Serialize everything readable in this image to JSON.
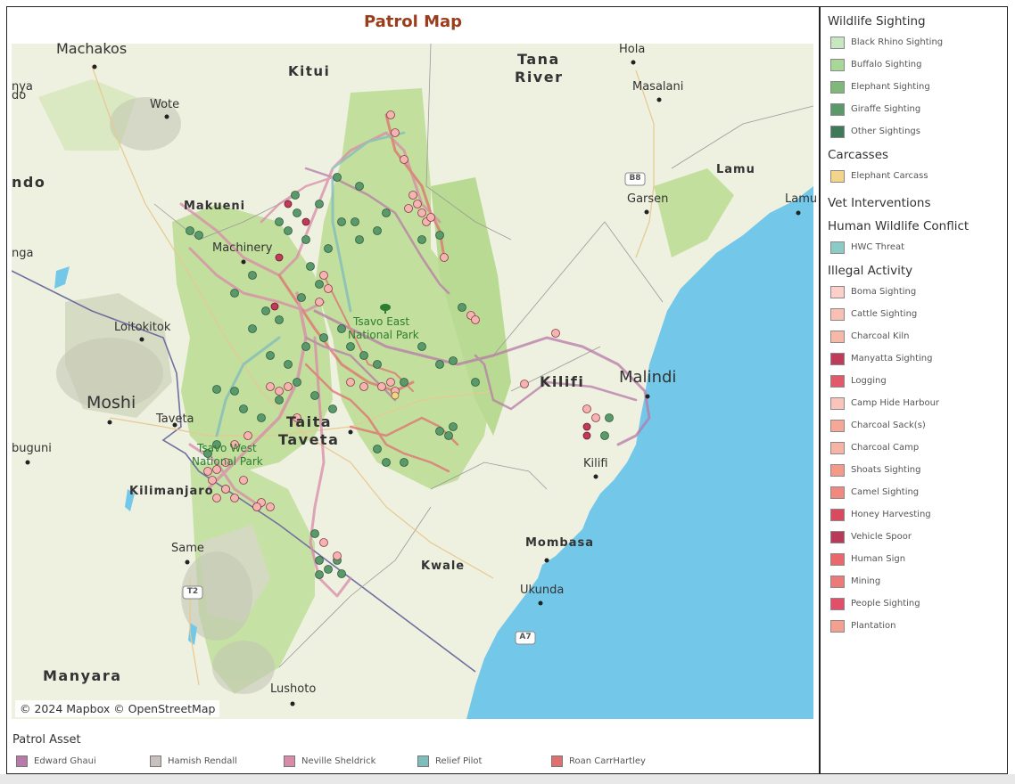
{
  "title": "Patrol Map",
  "map": {
    "attribution": "© 2024 Mapbox © OpenStreetMap",
    "places": [
      {
        "name": "Machakos"
      },
      {
        "name": "Kitui"
      },
      {
        "name": "Wote"
      },
      {
        "name": "Tana"
      },
      {
        "name": "River"
      },
      {
        "name": "Hola"
      },
      {
        "name": "Masalani"
      },
      {
        "name": "Makueni"
      },
      {
        "name": "Machinery"
      },
      {
        "name": "Loitokitok"
      },
      {
        "name": "Moshi"
      },
      {
        "name": "Taveta"
      },
      {
        "name": "Taita"
      },
      {
        "name": "Taveta"
      },
      {
        "name": "Kilimanjaro"
      },
      {
        "name": "Same"
      },
      {
        "name": "Manyara"
      },
      {
        "name": "Lushoto"
      },
      {
        "name": "Kwale"
      },
      {
        "name": "Mombasa"
      },
      {
        "name": "Ukunda"
      },
      {
        "name": "Kilifi"
      },
      {
        "name": "Kilifi"
      },
      {
        "name": "Malindi"
      },
      {
        "name": "Garsen"
      },
      {
        "name": "Lamu"
      },
      {
        "name": "Lamu"
      },
      {
        "name": "buguni"
      },
      {
        "name": "nya"
      },
      {
        "name": "do"
      },
      {
        "name": "ndo"
      },
      {
        "name": "nga"
      },
      {
        "name": "Tsavo East"
      },
      {
        "name": "National Park"
      },
      {
        "name": "Tsavo West"
      },
      {
        "name": "National Park"
      }
    ],
    "road_shields": [
      "B8",
      "T2",
      "A7"
    ]
  },
  "patrol_asset": {
    "title": "Patrol Asset",
    "items": [
      {
        "label": "Edward Ghaui",
        "color": "#b87aa8"
      },
      {
        "label": "Hamish Rendall",
        "color": "#c8c0bc"
      },
      {
        "label": "Neville Sheldrick",
        "color": "#d98aa8"
      },
      {
        "label": "Relief Pilot",
        "color": "#7fbcbc"
      },
      {
        "label": "Roan CarrHartley",
        "color": "#e07070"
      }
    ]
  },
  "legend": {
    "groups": [
      {
        "title": "Wildlife Sighting",
        "items": [
          {
            "label": "Black Rhino Sighting",
            "color": "#c8e6c0"
          },
          {
            "label": "Buffalo Sighting",
            "color": "#a8d898"
          },
          {
            "label": "Elephant Sighting",
            "color": "#7fb87a"
          },
          {
            "label": "Giraffe Sighting",
            "color": "#5a9a6a"
          },
          {
            "label": "Other Sightings",
            "color": "#3e7a5a"
          }
        ]
      },
      {
        "title": "Carcasses",
        "items": [
          {
            "label": "Elephant Carcass",
            "color": "#f2d48a"
          }
        ]
      },
      {
        "title": "Vet Interventions",
        "items": []
      },
      {
        "title": "Human Wildlife Conflict",
        "items": [
          {
            "label": "HWC Threat",
            "color": "#8ccac6"
          }
        ]
      },
      {
        "title": "Illegal Activity",
        "items": [
          {
            "label": "Boma Sighting",
            "color": "#fcd0c8"
          },
          {
            "label": "Cattle Sighting",
            "color": "#f8c0b4"
          },
          {
            "label": "Charcoal Kiln",
            "color": "#f6b8a8"
          },
          {
            "label": "Manyatta Sighting",
            "color": "#c03a5a"
          },
          {
            "label": "Logging",
            "color": "#e05a6a"
          },
          {
            "label": "Camp Hide Harbour",
            "color": "#f8c4bc"
          },
          {
            "label": "Charcoal Sack(s)",
            "color": "#f4a898"
          },
          {
            "label": "Charcoal Camp",
            "color": "#f6b4a4"
          },
          {
            "label": "Shoats Sighting",
            "color": "#f49a8a"
          },
          {
            "label": "Camel Sighting",
            "color": "#f08a80"
          },
          {
            "label": "Honey Harvesting",
            "color": "#d84a5e"
          },
          {
            "label": "Vehicle Spoor",
            "color": "#b83a58"
          },
          {
            "label": "Human Sign",
            "color": "#e8686c"
          },
          {
            "label": "Mining",
            "color": "#ec7a78"
          },
          {
            "label": "People Sighting",
            "color": "#e0506a"
          },
          {
            "label": "Plantation",
            "color": "#f4a090"
          }
        ]
      }
    ]
  }
}
